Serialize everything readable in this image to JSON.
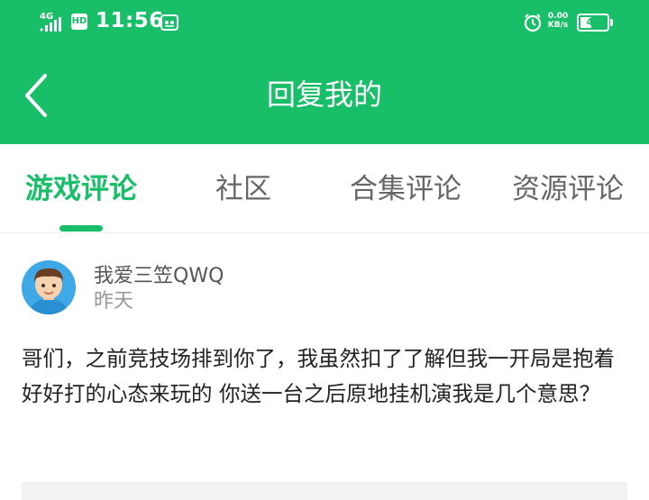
{
  "status_bar": {
    "network": "4G",
    "hd": "HD",
    "time": "11:56",
    "net_speed_value": "0.00",
    "net_speed_unit": "KB/s",
    "battery": "42",
    "battery_level": 0.42
  },
  "header": {
    "title": "回复我的"
  },
  "tabs": [
    {
      "label": "游戏评论",
      "active": true
    },
    {
      "label": "社区",
      "active": false
    },
    {
      "label": "合集评论",
      "active": false
    },
    {
      "label": "资源评论",
      "active": false
    }
  ],
  "post": {
    "username": "我爱三笠QWQ",
    "time": "昨天",
    "content": "哥们，之前竞技场排到你了，我虽然扣了了解但我一开局是抱着好好打的心态来玩的 你送一台之后原地挂机演我是几个意思？"
  },
  "colors": {
    "accent": "#19bf68",
    "text_primary": "#222222",
    "text_secondary": "#999999"
  }
}
